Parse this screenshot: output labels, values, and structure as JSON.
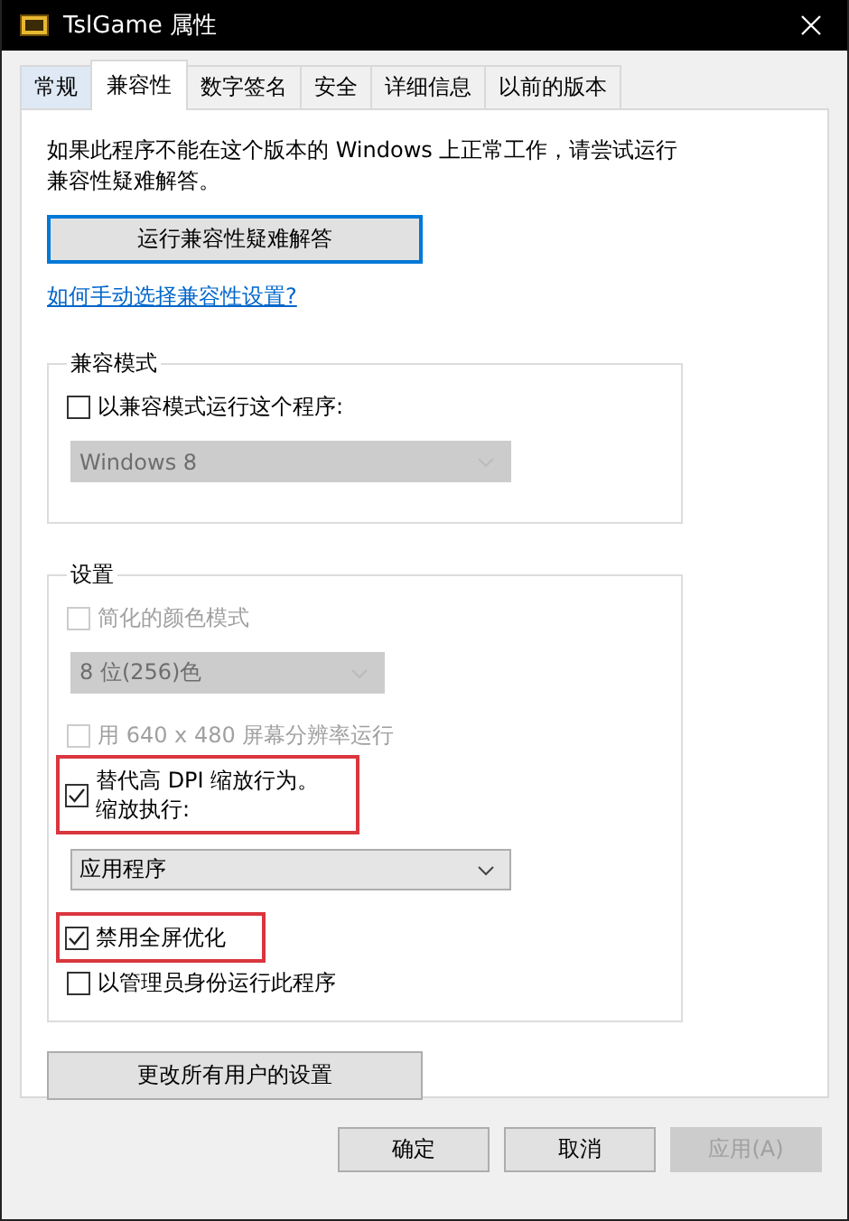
{
  "window": {
    "title": "TslGame 属性"
  },
  "tabs": [
    {
      "label": "常规",
      "selected": false
    },
    {
      "label": "兼容性",
      "selected": true
    },
    {
      "label": "数字签名",
      "selected": false
    },
    {
      "label": "安全",
      "selected": false
    },
    {
      "label": "详细信息",
      "selected": false
    },
    {
      "label": "以前的版本",
      "selected": false
    }
  ],
  "intro": "如果此程序不能在这个版本的 Windows 上正常工作，请尝试运行兼容性疑难解答。",
  "troubleshoot_button": "运行兼容性疑难解答",
  "help_link": "如何手动选择兼容性设置?",
  "compat_mode": {
    "title": "兼容模式",
    "items": [
      {
        "kind": "checkbox",
        "label": "以兼容模式运行这个程序:",
        "checked": false,
        "disabled": false,
        "highlighted": false
      },
      {
        "kind": "select",
        "value": "Windows 8",
        "disabled": true
      }
    ]
  },
  "settings": {
    "title": "设置",
    "items": [
      {
        "kind": "checkbox",
        "label": "简化的颜色模式",
        "checked": false,
        "disabled": true,
        "highlighted": false
      },
      {
        "kind": "short_select",
        "value": "8 位(256)色",
        "disabled": true
      },
      {
        "kind": "checkbox",
        "label": "用 640 x 480 屏幕分辨率运行",
        "checked": false,
        "disabled": true,
        "highlighted": false
      },
      {
        "kind": "checkbox",
        "label": "替代高 DPI 缩放行为。",
        "note": "缩放执行:",
        "checked": true,
        "disabled": false,
        "highlighted": true
      },
      {
        "kind": "select",
        "value": "应用程序",
        "disabled": false
      },
      {
        "kind": "checkbox",
        "label": "禁用全屏优化",
        "checked": true,
        "disabled": false,
        "highlighted": true
      },
      {
        "kind": "checkbox",
        "label": "以管理员身份运行此程序",
        "checked": false,
        "disabled": false,
        "highlighted": false
      }
    ]
  },
  "all_users_button": "更改所有用户的设置",
  "buttons": [
    {
      "label": "确定",
      "disabled": false
    },
    {
      "label": "取消",
      "disabled": false
    },
    {
      "label": "应用(A)",
      "disabled": true
    }
  ]
}
